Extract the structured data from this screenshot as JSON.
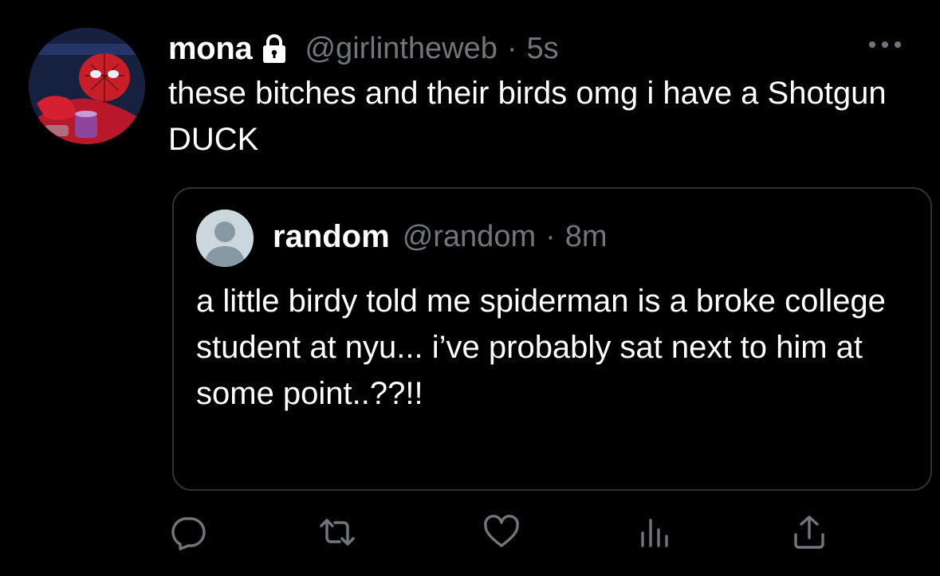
{
  "tweet": {
    "display_name": "mona",
    "handle": "@girlintheweb",
    "separator": "·",
    "time": "5s",
    "text": "these bitches and their birds omg i have a Shotgun DUCK",
    "avatar_icon": "spiderman-avatar",
    "protected_icon": "lock-icon",
    "more_icon": "more-icon"
  },
  "quote": {
    "display_name": "random",
    "handle": "@random",
    "separator": "·",
    "time": "8m",
    "text": "a little birdy told me spiderman is a broke college student at nyu... i’ve probably sat next to him at some point..??!!",
    "avatar_icon": "default-avatar"
  },
  "actions": [
    {
      "name": "reply",
      "icon": "reply-icon"
    },
    {
      "name": "retweet",
      "icon": "retweet-icon"
    },
    {
      "name": "like",
      "icon": "heart-icon"
    },
    {
      "name": "views",
      "icon": "views-icon"
    },
    {
      "name": "share",
      "icon": "share-icon"
    }
  ],
  "colors": {
    "background": "#000000",
    "text": "#ffffff",
    "secondary_text": "#71767b",
    "border": "#2f3336"
  }
}
